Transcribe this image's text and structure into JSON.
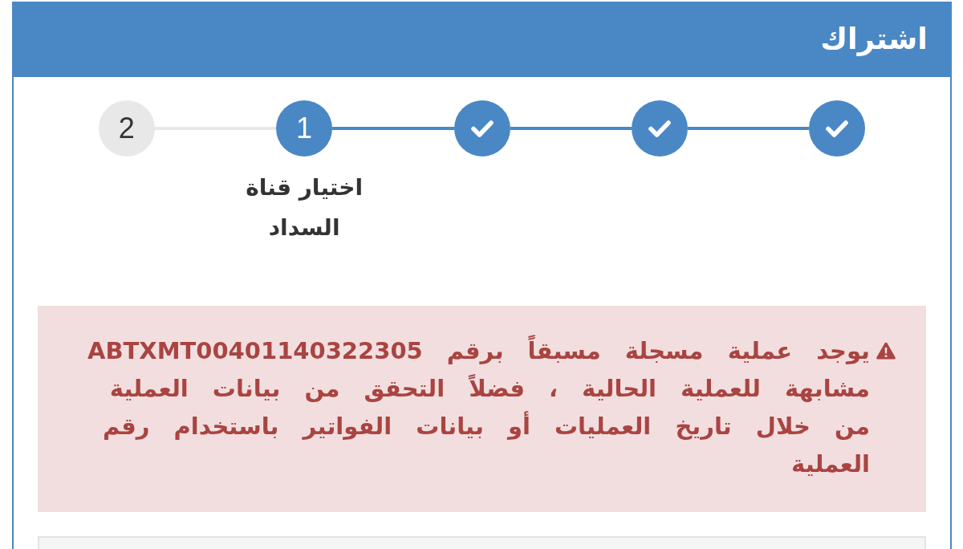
{
  "header": {
    "title": "اشتراك"
  },
  "steps": [
    {
      "completed": true,
      "selected": false
    },
    {
      "completed": true,
      "selected": false
    },
    {
      "completed": true,
      "selected": false
    },
    {
      "number": "1",
      "label": "اختيار قناة السداد",
      "completed": false,
      "selected": true
    },
    {
      "number": "2",
      "completed": false,
      "selected": false
    }
  ],
  "alert": {
    "text": "يوجد عملية مسجلة مسبقاً برقم ABTXMT00401140322305 مشابهة للعملية الحالية ، فضلاً التحقق من بيانات العملية من خلال تاريخ العمليات أو بيانات الفواتير باستخدام رقم العملية"
  }
}
